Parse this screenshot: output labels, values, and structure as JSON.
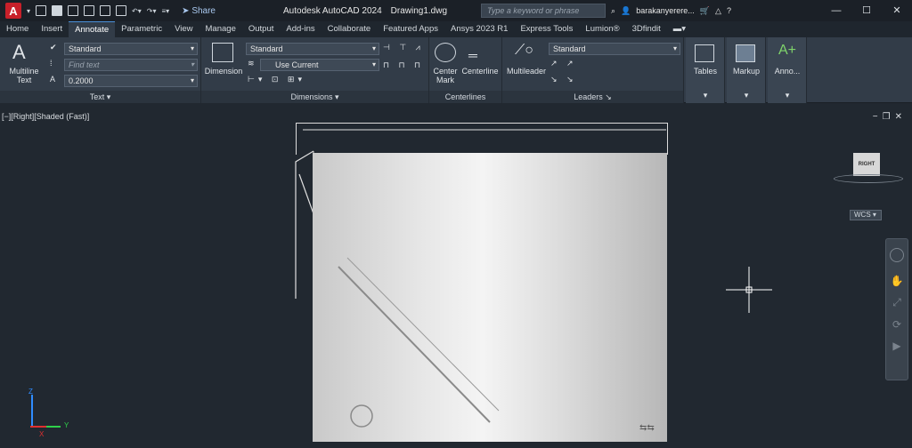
{
  "app": {
    "logo_letter": "A",
    "title": "Autodesk AutoCAD 2024",
    "drawing": "Drawing1.dwg",
    "share_label": "Share",
    "search_placeholder": "Type a keyword or phrase",
    "username": "barakanyerere...",
    "colors": {
      "logo": "#c8202a",
      "ribbon": "#323c48",
      "viewport": "#212830",
      "accent": "#4a90d9"
    }
  },
  "tabs": [
    "Home",
    "Insert",
    "Annotate",
    "Parametric",
    "View",
    "Manage",
    "Output",
    "Add-ins",
    "Collaborate",
    "Featured Apps",
    "Ansys 2023 R1",
    "Express Tools",
    "Lumion®",
    "3Dfindit"
  ],
  "active_tab": "Annotate",
  "ribbon": {
    "text_panel": {
      "title": "Text",
      "multiline_label": "Multiline\nText",
      "style_value": "Standard",
      "find_placeholder": "Find text",
      "height_value": "0.2000"
    },
    "dimensions_panel": {
      "title": "Dimensions",
      "dimension_label": "Dimension",
      "style_value": "Standard",
      "layer_value": "Use Current"
    },
    "centerlines_panel": {
      "title": "Centerlines",
      "center_mark_label": "Center\nMark",
      "centerline_label": "Centerline"
    },
    "leaders_panel": {
      "title": "Leaders",
      "multileader_label": "Multileader",
      "style_value": "Standard"
    },
    "tables_label": "Tables",
    "markup_label": "Markup",
    "annotation_label": "Anno..."
  },
  "viewport": {
    "label": "[−][Right][Shaded (Fast)]",
    "viewcube_face": "RIGHT",
    "wcs_label": "WCS",
    "axis_x": "X",
    "axis_y": "Y",
    "axis_z": "Z"
  }
}
